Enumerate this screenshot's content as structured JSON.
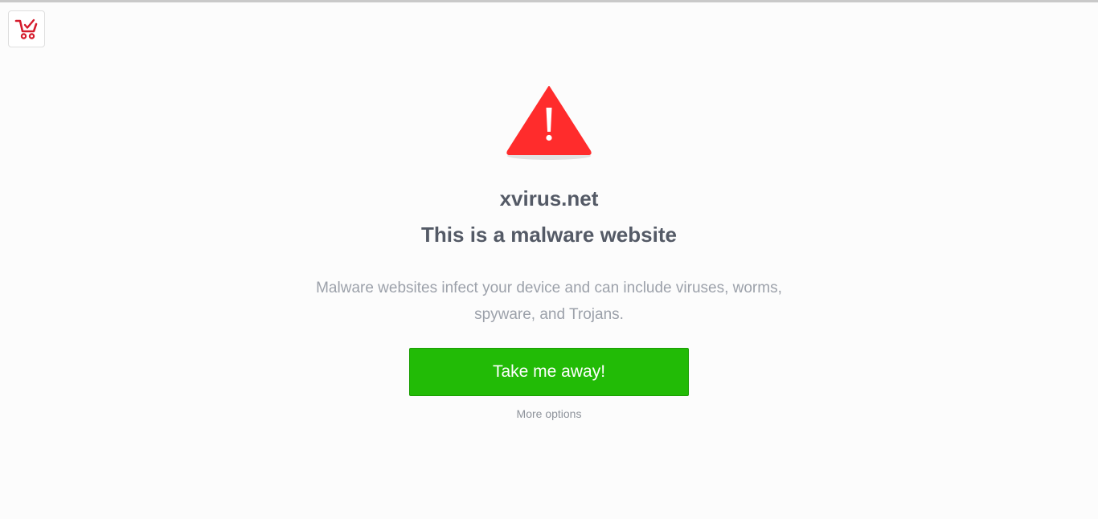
{
  "extension": {
    "icon": "shopping-cart-check-icon",
    "color": "#d51b2c"
  },
  "warning": {
    "icon": "warning-triangle-icon",
    "color": "#ff2c2c",
    "domain": "xvirus.net",
    "headline": "This is a malware website",
    "description": "Malware websites infect your device and can include viruses, worms, spyware, and Trojans."
  },
  "actions": {
    "primary_label": "Take me away!",
    "primary_color": "#22bb06",
    "secondary_label": "More options"
  }
}
